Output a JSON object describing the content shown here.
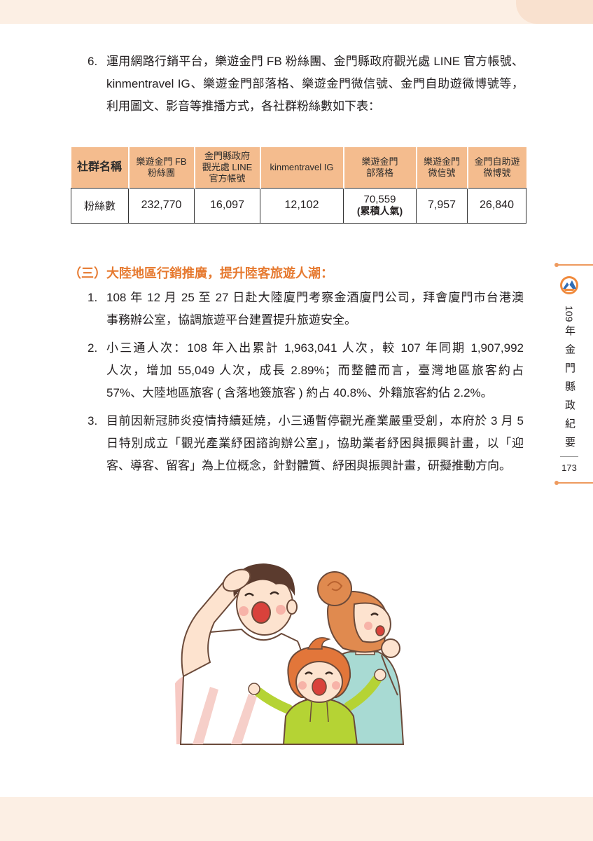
{
  "colors": {
    "accent_orange": "#E6792F",
    "table_header_bg": "#F4BC8E",
    "page_band": "#FCEFE4",
    "text": "#231F20"
  },
  "item6": {
    "number": "6.",
    "lines": [
      "運用網路行銷平台，樂遊金門 FB 粉絲團、金門縣政府觀光處 LINE 官方帳號、",
      "kinmentravel IG、樂遊金門部落格、樂遊金門微信號、金門自助遊微博號等，",
      "利用圖文、影音等推播方式，各社群粉絲數如下表："
    ]
  },
  "table": {
    "headers": [
      [
        "社群名稱"
      ],
      [
        "樂遊金門 FB",
        "粉絲團"
      ],
      [
        "金門縣政府",
        "觀光處 LINE",
        "官方帳號"
      ],
      [
        "kinmentravel IG"
      ],
      [
        "樂遊金門",
        "部落格"
      ],
      [
        "樂遊金門",
        "微信號"
      ],
      [
        "金門自助遊",
        "微博號"
      ]
    ],
    "row_label": "粉絲數",
    "values": [
      {
        "value": "232,770"
      },
      {
        "value": "16,097"
      },
      {
        "value": "12,102"
      },
      {
        "value": "70,559",
        "note": "(累積人氣)"
      },
      {
        "value": "7,957"
      },
      {
        "value": "26,840"
      }
    ]
  },
  "section3": {
    "heading": "（三）大陸地區行銷推廣，提升陸客旅遊人潮：",
    "items": [
      {
        "number": "1.",
        "lines": [
          "108 年 12 月 25 至 27 日赴大陸廈門考察金酒廈門公司，拜會廈門市台港澳",
          "事務辦公室，協調旅遊平台建置提升旅遊安全。"
        ]
      },
      {
        "number": "2.",
        "lines": [
          "小三通人次：108 年入出累計 1,963,041 人次，較 107 年同期 1,907,992",
          "人次，增加 55,049 人次，成長 2.89%；而整體而言，臺灣地區旅客約占",
          "57%、大陸地區旅客 ( 含落地簽旅客 ) 約占 40.8%、外籍旅客約佔 2.2%。"
        ]
      },
      {
        "number": "3.",
        "lines": [
          "目前因新冠肺炎疫情持續延燒，小三通暫停觀光產業嚴重受創，本府於 3 月 5",
          "日特別成立「觀光產業紓困諮詢辦公室」，協助業者紓困與振興計畫，以「迎",
          "客、導客、留客」為上位概念，針對體質、紓困與振興計畫，研擬推動方向。"
        ]
      }
    ]
  },
  "sidebar": {
    "emblem_icon": "county-emblem-icon",
    "title_year": "109",
    "title_text": "年金門縣政紀要",
    "page_number": "173"
  }
}
